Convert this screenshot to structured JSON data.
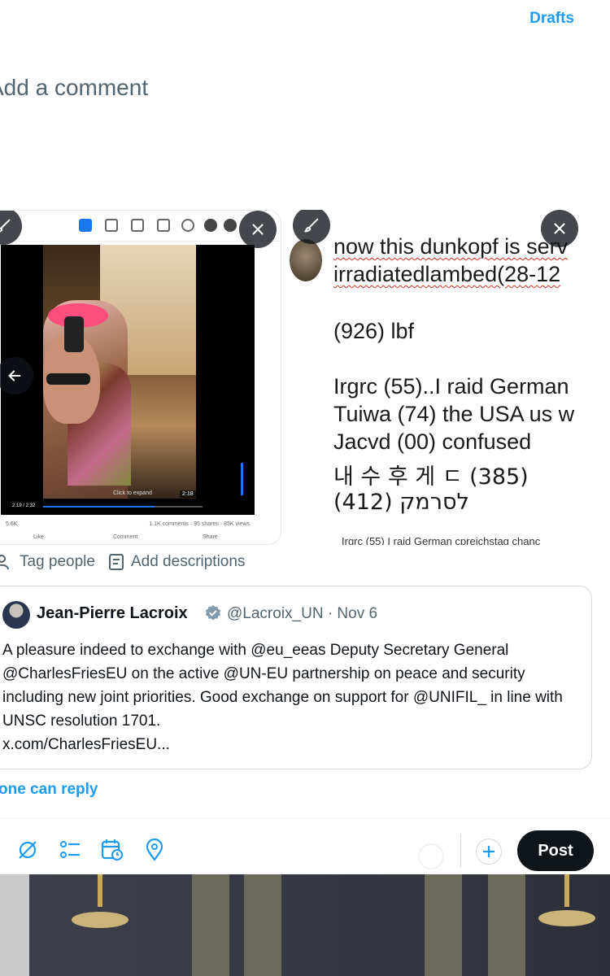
{
  "header": {
    "drafts_label": "Drafts"
  },
  "composer": {
    "placeholder": "Add a comment"
  },
  "media_left": {
    "video_time": "2:19 / 2:32",
    "click_to_expand": "Click to expand",
    "time_badge": "2:18",
    "reactions_count": "5.6K",
    "stats": "1.1K comments · 95 shares · 85K views",
    "like_label": "Like",
    "comment_label": "Comment",
    "share_label": "Share",
    "progress": 0.7
  },
  "media_right": {
    "lines": [
      "now this dunkopf is serv",
      "irradiatedlambed(28-12",
      "(926) lbf",
      "Irgrc (55)..I raid German",
      "Tuiwa (74) the USA us w",
      "Jacvd  (00) confused",
      "내 수 후 게 ㄷ (385)",
      "לסרמק   (412)"
    ],
    "tiny_line": "Irgrc (55)  I raid German cpreichstag chanc"
  },
  "media_tools": {
    "tag_people": "Tag people",
    "add_descriptions": "Add descriptions"
  },
  "quote": {
    "name": "Jean-Pierre Lacroix",
    "handle_date": "@Lacroix_UN · Nov 6",
    "body": "A pleasure indeed to exchange with @eu_eeas Deputy Secretary General @CharlesFriesEU on the active @UN-EU partnership on peace and security including new joint priorities. Good exchange on support for @UNIFIL_  in line with UNSC resolution 1701.",
    "link": "x.com/CharlesFriesEU..."
  },
  "reply_setting": "one can reply",
  "toolbar": {
    "post_label": "Post",
    "icons": [
      "grok-icon",
      "poll-icon",
      "schedule-icon",
      "location-icon"
    ]
  },
  "colors": {
    "accent": "#1d9bf0",
    "text": "#0f1419",
    "muted": "#536471",
    "post_bg": "#0f1419"
  }
}
